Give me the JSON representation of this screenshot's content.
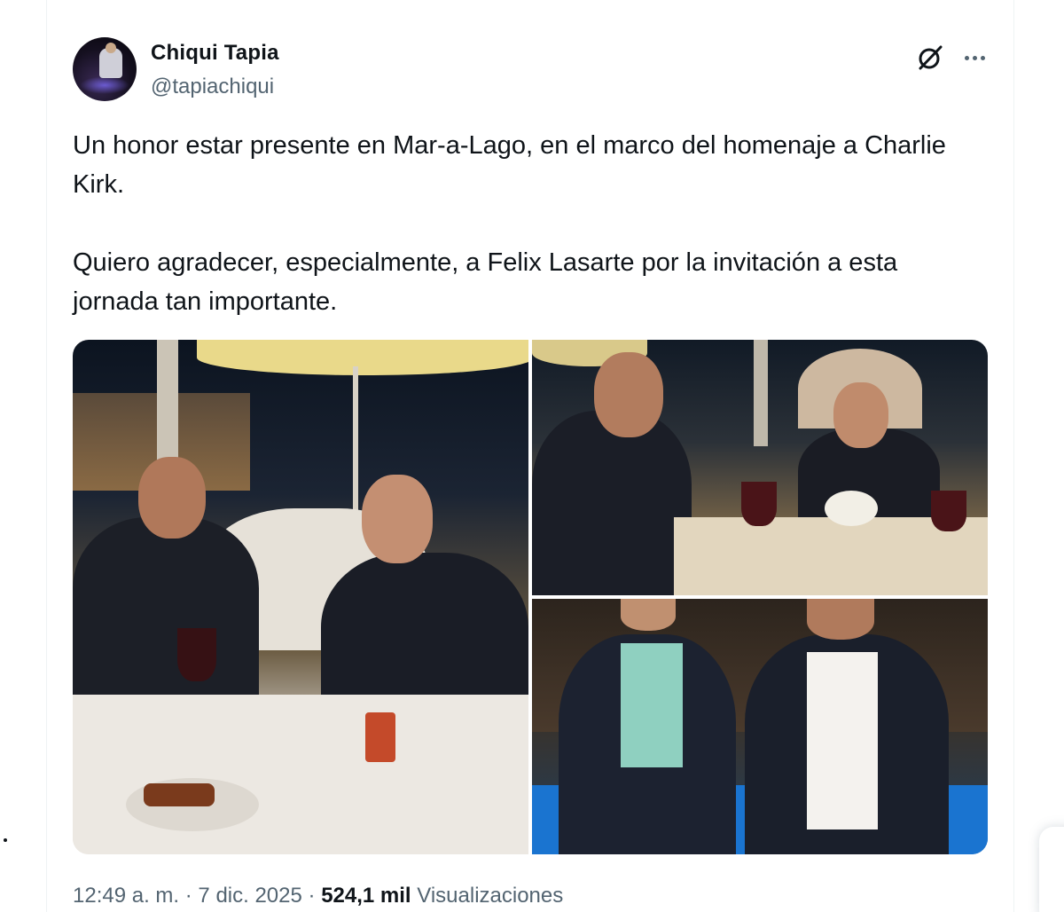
{
  "author": {
    "name": "Chiqui Tapia",
    "handle": "@tapiachiqui"
  },
  "tweet": {
    "paragraphs": [
      "Un honor estar presente en Mar-a-Lago, en el marco del homenaje a Charlie Kirk.",
      "Quiero agradecer, especialmente, a Felix Lasarte por la invitación a esta jornada tan importante."
    ],
    "media_count": 3
  },
  "meta": {
    "time": "12:49 a. m.",
    "separator": "·",
    "date": "7 dic. 2025",
    "views_count": "524,1 mil",
    "views_label": "Visualizaciones"
  },
  "icons": {
    "grok": "grok-icon",
    "more": "more-icon"
  },
  "colors": {
    "text_primary": "#0f1419",
    "text_secondary": "#536471",
    "border": "#eff3f4"
  }
}
